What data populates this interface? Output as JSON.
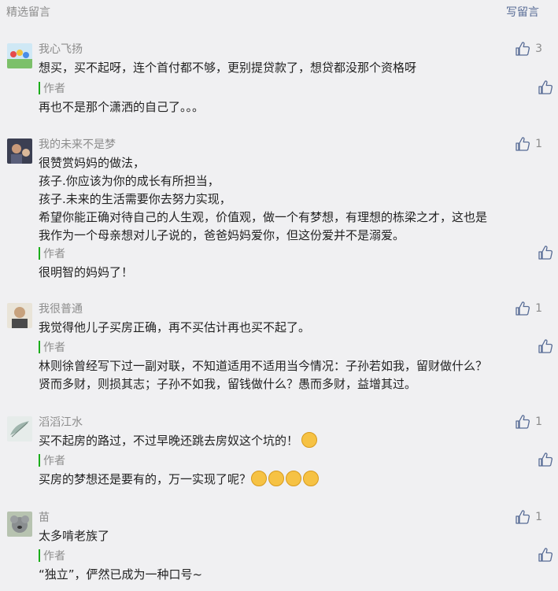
{
  "header": {
    "title": "精选留言",
    "write_label": "写留言"
  },
  "comments": [
    {
      "nickname": "我心飞扬",
      "likes": "3",
      "text": "想买，买不起呀，连个首付都不够，更别提贷款了，想贷都没那个资格呀",
      "author_label": "作者",
      "reply": "再也不是那个潇洒的自己了。。。"
    },
    {
      "nickname": "我的未来不是梦",
      "likes": "1",
      "text": "很赞赏妈妈的做法，\n孩子.你应该为你的成长有所担当，\n孩子.未来的生活需要你去努力实现，\n希望你能正确对待自己的人生观，价值观，做一个有梦想，有理想的栋梁之才，这也是\n我作为一个母亲想对儿子说的，爸爸妈妈爱你，但这份爱并不是溺爱。",
      "author_label": "作者",
      "reply": "很明智的妈妈了！"
    },
    {
      "nickname": "我很普通",
      "likes": "1",
      "text": "我觉得他儿子买房正确，再不买估计再也买不起了。",
      "author_label": "作者",
      "reply": "林则徐曾经写下过一副对联，不知道适用不适用当今情况：子孙若如我，留财做什么？\n贤而多财，则损其志；子孙不如我，留钱做什么？愚而多财，益增其过。"
    },
    {
      "nickname": "滔滔江水",
      "likes": "1",
      "text": "买不起房的路过，不过早晚还跳去房奴这个坑的！",
      "author_label": "作者",
      "reply": "买房的梦想还是要有的，万一实现了呢？"
    },
    {
      "nickname": "苗",
      "likes": "1",
      "text": "太多啃老族了",
      "author_label": "作者",
      "reply": "“独立”，俨然已成为一种口号~"
    }
  ],
  "colors": {
    "link": "#576b95",
    "meta": "#8c8c8c",
    "author_bar": "#1aad19",
    "bg": "#f0f0f2"
  }
}
